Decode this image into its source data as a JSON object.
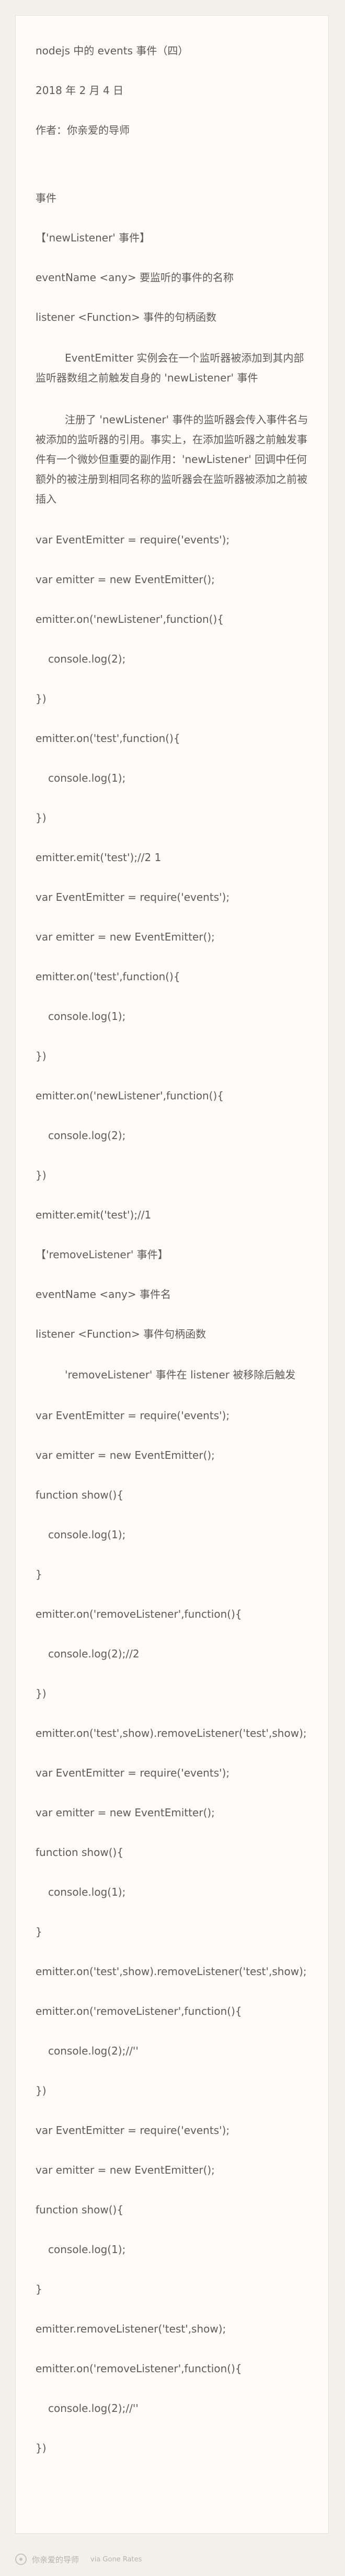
{
  "doc": {
    "title": "nodejs 中的 events 事件（四）",
    "date": "2018 年 2 月 4 日",
    "author": "作者：你亲爱的导师",
    "lines": [
      "事件",
      "【'newListener' 事件】",
      "eventName <any> 要监听的事件的名称",
      "listener <Function> 事件的句柄函数",
      "EventEmitter 实例会在一个监听器被添加到其内部监听器数组之前触发自身的 'newListener' 事件",
      "注册了 'newListener' 事件的监听器会传入事件名与被添加的监听器的引用。事实上，在添加监听器之前触发事件有一个微妙但重要的副作用：'newListener' 回调中任何额外的被注册到相同名称的监听器会在监听器被添加之前被插入",
      "var EventEmitter = require('events');",
      "var emitter = new EventEmitter();",
      "emitter.on('newListener',function(){",
      "console.log(2);",
      "})",
      "emitter.on('test',function(){",
      "console.log(1);",
      "})",
      "emitter.emit('test');//2 1",
      "var EventEmitter = require('events');",
      "var emitter = new EventEmitter();",
      "emitter.on('test',function(){",
      "console.log(1);",
      "})",
      "emitter.on('newListener',function(){",
      "console.log(2);",
      "})",
      "emitter.emit('test');//1",
      "【'removeListener' 事件】",
      "eventName <any> 事件名",
      "listener <Function> 事件句柄函数",
      "'removeListener' 事件在 listener 被移除后触发",
      "var EventEmitter = require('events');",
      "var emitter = new EventEmitter();",
      "function show(){",
      "console.log(1);",
      "}",
      "emitter.on('removeListener',function(){",
      "console.log(2);//2",
      "})",
      "emitter.on('test',show).removeListener('test',show);",
      "var EventEmitter = require('events');",
      "var emitter = new EventEmitter();",
      "function show(){",
      "console.log(1);",
      "}",
      "emitter.on('test',show).removeListener('test',show);",
      "emitter.on('removeListener',function(){",
      "console.log(2);//''",
      "})",
      "var EventEmitter = require('events');",
      "var emitter = new EventEmitter();",
      "function show(){",
      "console.log(1);",
      "}",
      "emitter.removeListener('test',show);",
      "emitter.on('removeListener',function(){",
      "console.log(2);//''",
      "})"
    ]
  },
  "footer": {
    "brand": "你亲爱的导师",
    "sub": "via Gone Rates"
  }
}
